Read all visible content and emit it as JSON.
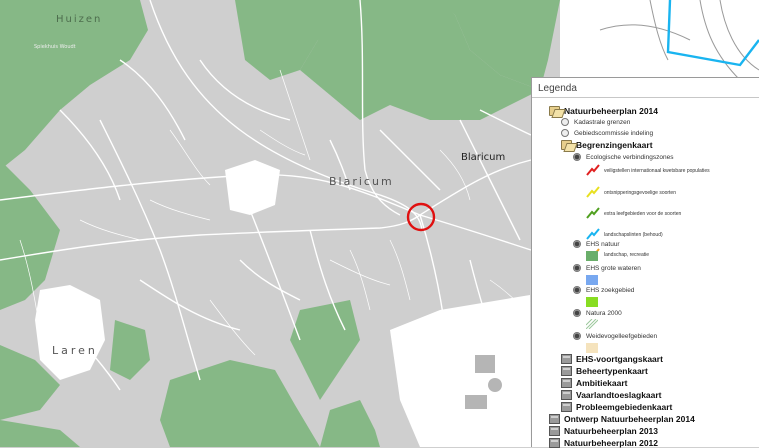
{
  "map": {
    "labels": {
      "huizen": "Huizen",
      "blaricum_center": "Blaricum",
      "blaricum_right": "Blaricum",
      "laren": "Laren",
      "small_top": "Spiekhuis Woudt"
    },
    "colors": {
      "urban": "#cfcfcf",
      "road": "#ffffff",
      "nature": "#86b886",
      "marker": "#e01010",
      "boundary": "#19b4f0"
    }
  },
  "legend": {
    "title": "Legenda",
    "items": [
      {
        "label": "Natuurbeheerplan 2014",
        "icon": "folder-open-icon"
      },
      {
        "label": "Kadastrale grenzen",
        "icon": "radio-icon"
      },
      {
        "label": "Gebiedscommissie indeling",
        "icon": "radio-icon"
      },
      {
        "label": "Begrenzingenkaart",
        "icon": "folder-open-icon"
      },
      {
        "label": "Ecologische verbindingszones",
        "icon": "radio-icon"
      },
      {
        "label": "veiligstellen internationaal kwetsbare populaties",
        "color": "#e02020"
      },
      {
        "label": "ontsnipperingsgevoelige soorten",
        "color": "#e8e020"
      },
      {
        "label": "extra leefgebieden voor de soorten",
        "color": "#50a020"
      },
      {
        "label": "landschapslinten (behoud)",
        "color": "#19b4f0"
      },
      {
        "label": "landschap, recreatie",
        "color": "#f0a020"
      },
      {
        "label": "EHS natuur",
        "color": "#6aae6a"
      },
      {
        "label": "EHS grote wateren",
        "color": "#78a8f0"
      },
      {
        "label": "EHS zoekgebied",
        "color": "#88dd22"
      },
      {
        "label": "Natura 2000",
        "color": "#9cc89c"
      },
      {
        "label": "Weidevogelleefgebieden",
        "color": "#f5e3bd"
      },
      {
        "label": "EHS-voortgangskaart",
        "icon": "folder-closed-icon"
      },
      {
        "label": "Beheertypenkaart",
        "icon": "folder-closed-icon"
      },
      {
        "label": "Ambitiekaart",
        "icon": "folder-closed-icon"
      },
      {
        "label": "Vaarlandtoeslagkaart",
        "icon": "folder-closed-icon"
      },
      {
        "label": "Probleemgebiedenkaart",
        "icon": "folder-closed-icon"
      },
      {
        "label": "Ontwerp Natuurbeheerplan 2014",
        "icon": "folder-closed-icon"
      },
      {
        "label": "Natuurbeheerplan 2013",
        "icon": "folder-closed-icon"
      },
      {
        "label": "Natuurbeheerplan 2012",
        "icon": "folder-closed-icon"
      }
    ]
  }
}
